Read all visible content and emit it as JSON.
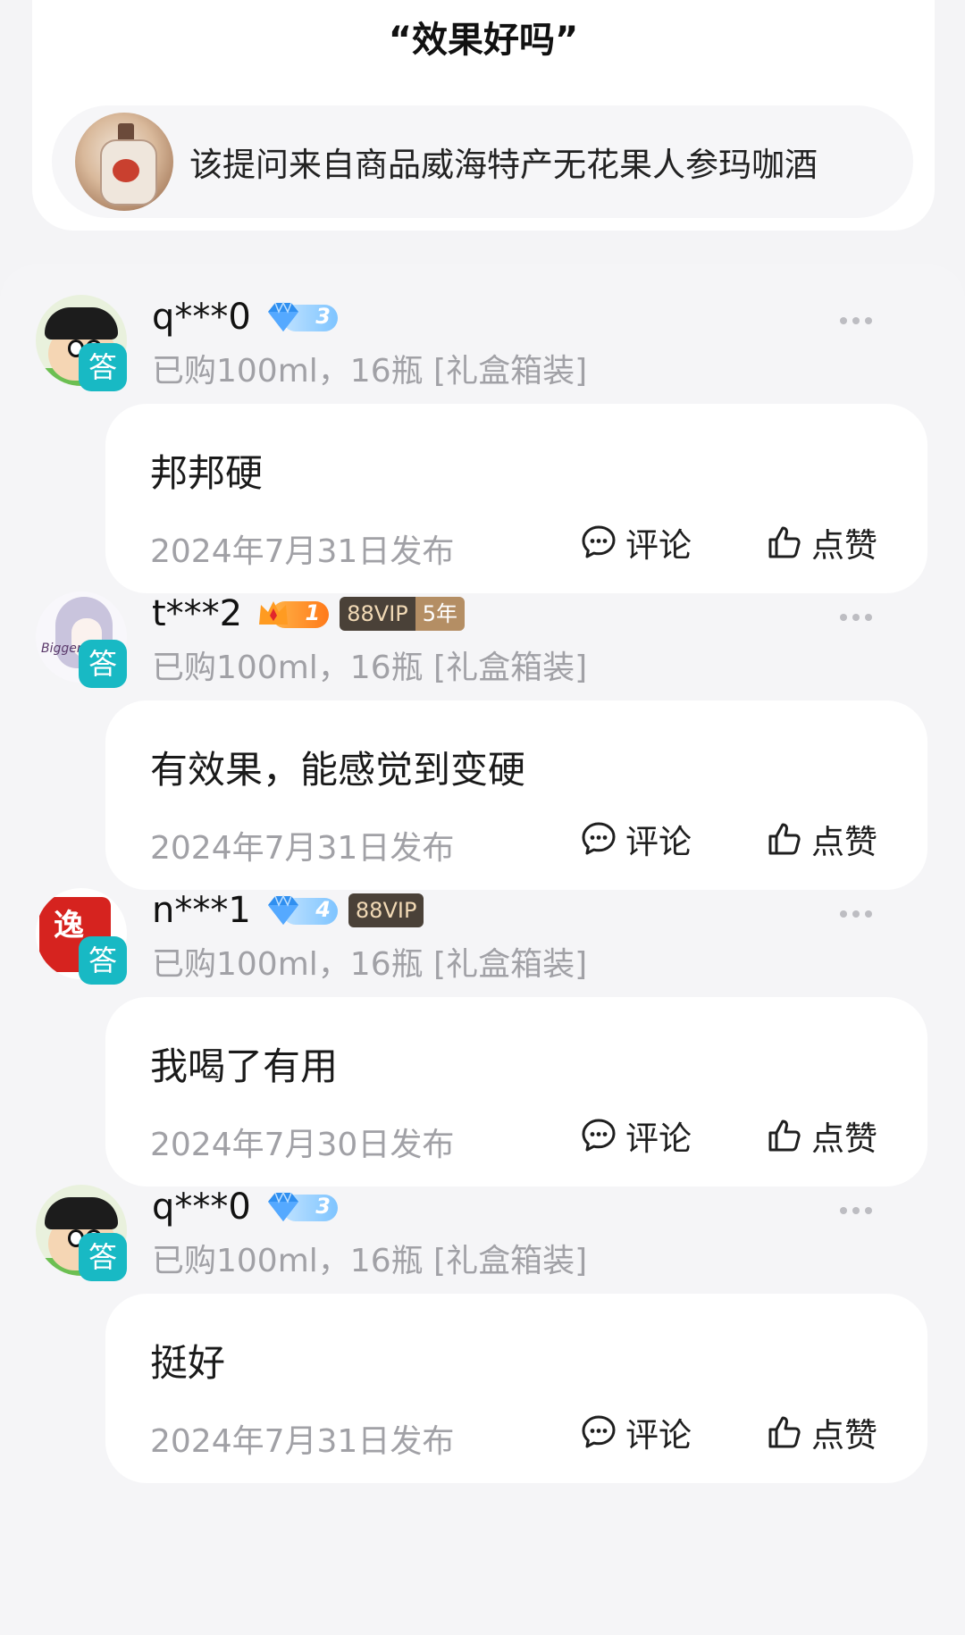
{
  "question": {
    "title": "“效果好吗”",
    "source_text": "该提问来自商品威海特产无花果人参玛咖酒"
  },
  "answers": [
    {
      "username": "q***0",
      "avatar": "crayon-shin-chan",
      "badge_type": "diamond",
      "level": "3",
      "vip": "",
      "vip_years": "",
      "tag": "答",
      "purchase": "已购100ml，16瓶 [礼盒箱装]",
      "content": "邦邦硬",
      "date": "2024年7月31日发布",
      "comment_label": "评论",
      "like_label": "点赞"
    },
    {
      "username": "t***2",
      "avatar": "anime-sketch",
      "badge_type": "crown",
      "level": "1",
      "vip": "88VIP",
      "vip_years": "5年",
      "tag": "答",
      "purchase": "已购100ml，16瓶 [礼盒箱装]",
      "content": "有效果，能感觉到变硬",
      "date": "2024年7月31日发布",
      "comment_label": "评论",
      "like_label": "点赞"
    },
    {
      "username": "n***1",
      "avatar": "red-seal",
      "avatar_text": "逸",
      "badge_type": "diamond",
      "level": "4",
      "vip": "88VIP",
      "vip_years": "",
      "tag": "答",
      "purchase": "已购100ml，16瓶 [礼盒箱装]",
      "content": "我喝了有用",
      "date": "2024年7月30日发布",
      "comment_label": "评论",
      "like_label": "点赞"
    },
    {
      "username": "q***0",
      "avatar": "crayon-shin-chan",
      "badge_type": "diamond",
      "level": "3",
      "vip": "",
      "vip_years": "",
      "tag": "答",
      "purchase": "已购100ml，16瓶 [礼盒箱装]",
      "content": "挺好",
      "date": "2024年7月31日发布",
      "comment_label": "评论",
      "like_label": "点赞"
    }
  ],
  "icons": {
    "more": "more-dots-icon",
    "comment": "comment-bubble-icon",
    "like": "thumbs-up-icon",
    "diamond": "diamond-icon",
    "crown": "crown-icon"
  },
  "colors": {
    "answer_tag": "#18b9c4",
    "muted_text": "#a1a1a6",
    "vip_dark": "#4a4138",
    "vip_gold": "#b48e64"
  }
}
